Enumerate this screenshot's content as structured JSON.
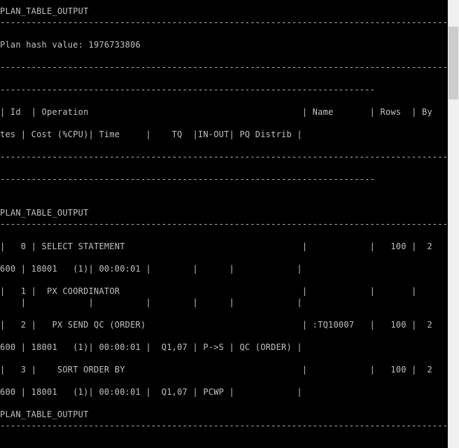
{
  "console": {
    "lines": [
      {
        "text": "PLAN_TABLE_OUTPUT"
      },
      {
        "text": "------------------------------------------------------------------------------------------------------------------------------------------------------------------------------"
      },
      {
        "text": "Plan hash value: 1976733806"
      },
      {
        "text": "------------------------------------------------------------------------------------------------------------------------------------------------------------------------------"
      },
      {
        "text": "------------------------------------------------------------------------"
      },
      {
        "text": "| Id  | Operation                                         | Name       | Rows  | By"
      },
      {
        "text": "tes | Cost (%CPU)| Time     |    TQ  |IN-OUT| PQ Distrib |"
      },
      {
        "text": "------------------------------------------------------------------------------------------------------------------------------------------------------------------------------"
      },
      {
        "text": "------------------------------------------------------------------------"
      },
      {
        "text": "PLAN_TABLE_OUTPUT"
      },
      {
        "text": "------------------------------------------------------------------------------------------------------------------------------------------------------------------------------"
      },
      {
        "text": "|   0 | SELECT STATEMENT                                  |            |   100 |  2"
      },
      {
        "text": "600 | 18001   (1)| 00:00:01 |        |      |            |"
      },
      {
        "text": "|   1 |  PX COORDINATOR                                   |            |       |"
      },
      {
        "text": "    |            |          |        |      |            |"
      },
      {
        "text": "|   2 |   PX SEND QC (ORDER)                              | :TQ10007   |   100 |  2"
      },
      {
        "text": "600 | 18001   (1)| 00:00:01 |  Q1,07 | P->S | QC (ORDER) |"
      },
      {
        "text": "|   3 |    SORT ORDER BY                                  |            |   100 |  2"
      },
      {
        "text": "600 | 18001   (1)| 00:00:01 |  Q1,07 | PCWP |            |"
      },
      {
        "text": "PLAN_TABLE_OUTPUT"
      },
      {
        "text": "------------------------------------------------------------------------------------------------------------------------------------------------------------------------------"
      }
    ]
  },
  "colors": {
    "background": "#000000",
    "text": "#c0c0c0",
    "scrollbar_track": "#f0f0f0",
    "scrollbar_thumb": "#cdcdcd"
  }
}
